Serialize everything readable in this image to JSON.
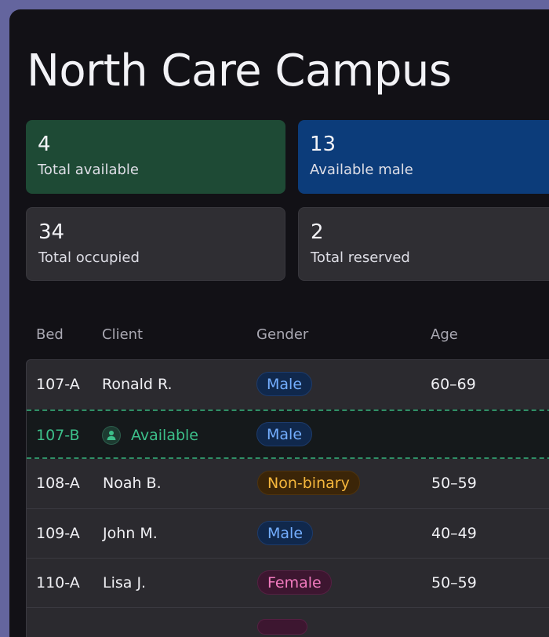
{
  "page": {
    "title": "North Care Campus"
  },
  "stats": [
    {
      "value": "4",
      "label": "Total available"
    },
    {
      "value": "13",
      "label": "Available male"
    },
    {
      "value": "34",
      "label": "Total occupied"
    },
    {
      "value": "2",
      "label": "Total reserved"
    }
  ],
  "table": {
    "headers": {
      "bed": "Bed",
      "client": "Client",
      "gender": "Gender",
      "age": "Age"
    },
    "rows": [
      {
        "bed": "107-A",
        "client": "Ronald R.",
        "gender": "Male",
        "age": "60–69"
      },
      {
        "bed": "107-B",
        "client": "Available",
        "gender": "Male",
        "age": ""
      },
      {
        "bed": "108-A",
        "client": "Noah B.",
        "gender": "Non-binary",
        "age": "50–59"
      },
      {
        "bed": "109-A",
        "client": "John M.",
        "gender": "Male",
        "age": "40–49"
      },
      {
        "bed": "110-A",
        "client": "Lisa J.",
        "gender": "Female",
        "age": "50–59"
      }
    ]
  },
  "colors": {
    "available_card": "#1e4a35",
    "male_card": "#0c3c7a",
    "male_pill": "#74aeff",
    "nonbinary_pill": "#f6b73c",
    "female_pill": "#f27bbf",
    "available_text": "#3cc08a"
  },
  "icons": {
    "available_person": "person-icon"
  }
}
